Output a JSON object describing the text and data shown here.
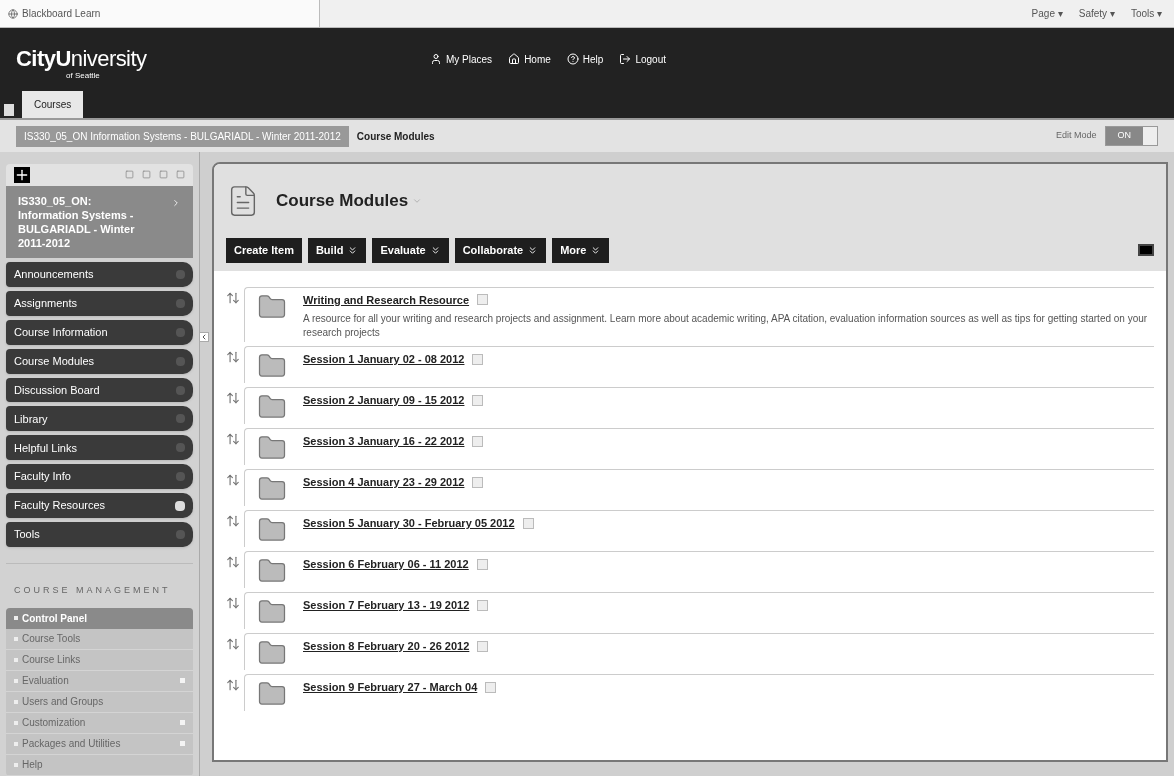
{
  "browser": {
    "tab_title": "Blackboard Learn",
    "toolbar_menus": [
      "Page ▾",
      "Safety ▾",
      "Tools ▾"
    ]
  },
  "header": {
    "logo_main": "City",
    "logo_bold": "U",
    "logo_rest": "niversity",
    "logo_sub": "of Seattle",
    "nav": [
      {
        "label": "My Places",
        "kind": "person"
      },
      {
        "label": "Home",
        "kind": "home"
      },
      {
        "label": "Help",
        "kind": "help"
      },
      {
        "label": "Logout",
        "kind": "logout"
      }
    ],
    "tabs": [
      {
        "label": "Courses",
        "selected": true
      }
    ]
  },
  "breadcrumb": {
    "course": "IS330_05_ON Information Systems - BULGARIADL - Winter 2011-2012",
    "page": "Course Modules",
    "edit_mode_label": "Edit Mode",
    "edit_mode_value": "ON",
    "edit_mode_on": true
  },
  "sidebar": {
    "course_title": "IS330_05_ON: Information Systems - BULGARIADL - Winter 2011-2012",
    "menu": [
      {
        "label": "Announcements",
        "has_badge": false
      },
      {
        "label": "Assignments",
        "has_badge": false
      },
      {
        "label": "Course Information",
        "has_badge": false
      },
      {
        "label": "Course Modules",
        "has_badge": false
      },
      {
        "label": "Discussion Board",
        "has_badge": false
      },
      {
        "label": "Library",
        "has_badge": false
      },
      {
        "label": "Helpful Links",
        "has_badge": false
      },
      {
        "label": "Faculty Info",
        "has_badge": false
      },
      {
        "label": "Faculty Resources",
        "has_badge": true
      },
      {
        "label": "Tools",
        "has_badge": false
      }
    ],
    "management_title": "COURSE MANAGEMENT",
    "management": [
      {
        "label": "Control Panel",
        "selected": true,
        "has_submenu": false
      },
      {
        "label": "Course Tools",
        "selected": false,
        "has_submenu": false
      },
      {
        "label": "Course Links",
        "selected": false,
        "has_submenu": false
      },
      {
        "label": "Evaluation",
        "selected": false,
        "has_submenu": true
      },
      {
        "label": "Users and Groups",
        "selected": false,
        "has_submenu": false
      },
      {
        "label": "Customization",
        "selected": false,
        "has_submenu": true
      },
      {
        "label": "Packages and Utilities",
        "selected": false,
        "has_submenu": true
      },
      {
        "label": "Help",
        "selected": false,
        "has_submenu": false
      }
    ]
  },
  "content": {
    "title": "Course Modules",
    "toolbar": [
      {
        "label": "Create Item",
        "dropdown": false
      },
      {
        "label": "Build",
        "dropdown": true
      },
      {
        "label": "Evaluate",
        "dropdown": true
      },
      {
        "label": "Collaborate",
        "dropdown": true
      },
      {
        "label": "More",
        "dropdown": true
      }
    ],
    "items": [
      {
        "title": "Writing and Research Resource",
        "description": "A resource for all your writing and research projects and assignment. Learn more about academic writing, APA citation, evaluation information sources as well as tips for getting started on your research projects"
      },
      {
        "title": "Session 1 January 02 - 08 2012"
      },
      {
        "title": "Session 2 January 09 - 15 2012"
      },
      {
        "title": "Session 3 January 16 - 22 2012"
      },
      {
        "title": "Session 4 January 23 - 29 2012"
      },
      {
        "title": "Session 5 January 30 - February 05 2012"
      },
      {
        "title": "Session 6 February 06 - 11 2012"
      },
      {
        "title": "Session 7 February 13 - 19 2012"
      },
      {
        "title": "Session 8 February 20 - 26 2012"
      },
      {
        "title": "Session 9 February 27 - March 04"
      }
    ]
  }
}
